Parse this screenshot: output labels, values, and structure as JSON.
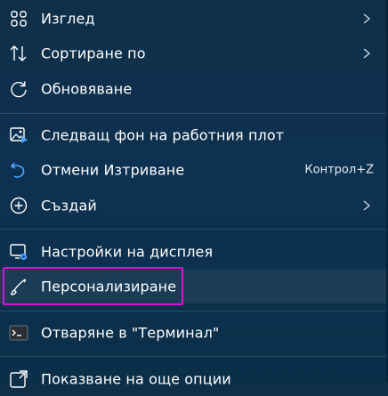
{
  "menu": {
    "items": [
      {
        "label": "Изглед",
        "icon": "grid-view-icon",
        "submenu": true
      },
      {
        "label": "Сортиране по",
        "icon": "sort-icon",
        "submenu": true
      },
      {
        "label": "Обновяване",
        "icon": "refresh-icon"
      },
      {
        "label": "Следващ фон на работния плот",
        "icon": "next-wallpaper-icon"
      },
      {
        "label": "Отмени Изтриване",
        "icon": "undo-icon",
        "shortcut": "Контрол+Z"
      },
      {
        "label": "Създай",
        "icon": "add-circle-icon",
        "submenu": true
      },
      {
        "label": "Настройки на дисплея",
        "icon": "display-settings-icon"
      },
      {
        "label": "Персонализиране",
        "icon": "brush-icon",
        "highlighted": true
      },
      {
        "label": "Отваряне в \"Терминал\"",
        "icon": "terminal-icon"
      },
      {
        "label": "Показване на още опции",
        "icon": "more-options-icon"
      }
    ]
  },
  "colors": {
    "highlight_border": "#d316d6",
    "accent_blue": "#4ea4ff",
    "background": "#0d3150"
  }
}
